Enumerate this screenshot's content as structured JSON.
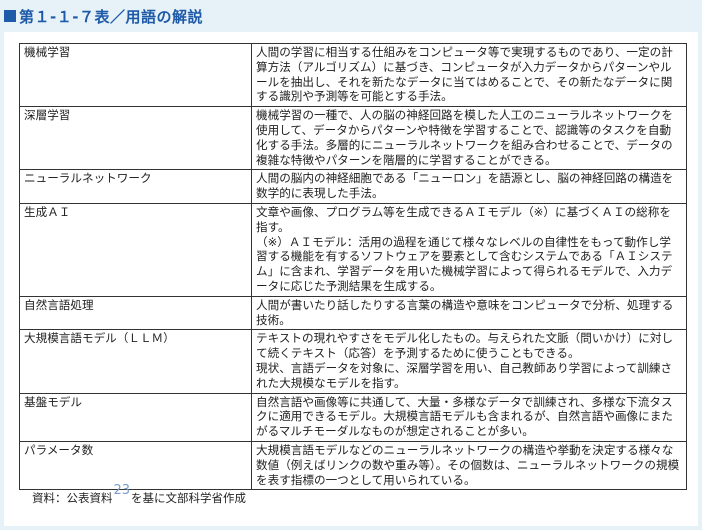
{
  "header": {
    "title": "第１-１-７表／用語の解説"
  },
  "table": {
    "rows": [
      {
        "term": "機械学習",
        "desc": "人間の学習に相当する仕組みをコンピュータ等で実現するものであり、一定の計算方法（アルゴリズム）に基づき、コンピュータが入力データからパターンやルールを抽出し、それを新たなデータに当てはめることで、その新たなデータに関する識別や予測等を可能とする手法。"
      },
      {
        "term": "深層学習",
        "desc": "機械学習の一種で、人の脳の神経回路を模した人工のニューラルネットワークを使用して、データからパターンや特徴を学習することで、認識等のタスクを自動化する手法。多層的にニューラルネットワークを組み合わせることで、データの複雑な特徴やパターンを階層的に学習することができる。"
      },
      {
        "term": "ニューラルネットワーク",
        "desc": "人間の脳内の神経細胞である「ニューロン」を語源とし、脳の神経回路の構造を数学的に表現した手法。"
      },
      {
        "term": "生成ＡＩ",
        "desc": "文章や画像、プログラム等を生成できるＡＩモデル（※）に基づくＡＩの総称を指す。",
        "desc2": "（※）ＡＩモデル：活用の過程を通じて様々なレベルの自律性をもって動作し学習する機能を有するソフトウェアを要素として含むシステムである「ＡＩシステム」に含まれ、学習データを用いた機械学習によって得られるモデルで、入力データに応じた予測結果を生成する。"
      },
      {
        "term": "自然言語処理",
        "desc": "人間が書いたり話したりする言葉の構造や意味をコンピュータで分析、処理する技術。"
      },
      {
        "term": "大規模言語モデル（ＬＬＭ）",
        "desc": "テキストの現れやすさをモデル化したもの。与えられた文脈（問いかけ）に対して続くテキスト（応答）を予測するために使うこともできる。",
        "desc2": "現状、言語データを対象に、深層学習を用い、自己教師あり学習によって訓練された大規模なモデルを指す。"
      },
      {
        "term": "基盤モデル",
        "desc": "自然言語や画像等に共通して、大量・多様なデータで訓練され、多様な下流タスクに適用できるモデル。大規模言語モデルも含まれるが、自然言語や画像にまたがるマルチモーダルなものが想定されることが多い。"
      },
      {
        "term": "パラメータ数",
        "desc": "大規模言語モデルなどのニューラルネットワークの構造や挙動を決定する様々な数値（例えばリンクの数や重み等）。その個数は、ニューラルネットワークの規模を表す指標の一つとして用いられている。"
      }
    ]
  },
  "source": {
    "prefix": "資料：公表資料",
    "ref": "23",
    "suffix": "を基に文部科学省作成"
  },
  "colors": {
    "accent": "#1e5aa8",
    "background": "#e6f1f8",
    "ref": "#7a9ecf"
  }
}
